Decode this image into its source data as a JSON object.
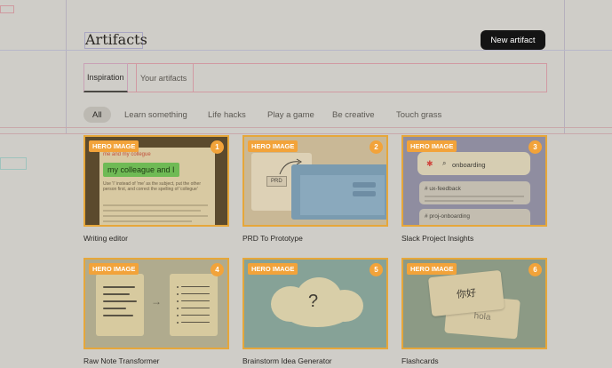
{
  "header": {
    "title": "Artifacts",
    "new_button": "New artifact"
  },
  "tabs": [
    {
      "label": "Inspiration",
      "active": true
    },
    {
      "label": "Your artifacts",
      "active": false
    }
  ],
  "filters": [
    {
      "label": "All",
      "active": true
    },
    {
      "label": "Learn something"
    },
    {
      "label": "Life hacks"
    },
    {
      "label": "Play a game"
    },
    {
      "label": "Be creative"
    },
    {
      "label": "Touch grass"
    }
  ],
  "cards": [
    {
      "badge": "HERO IMAGE",
      "number": "1",
      "label": "Writing editor"
    },
    {
      "badge": "HERO IMAGE",
      "number": "2",
      "label": "PRD To Prototype"
    },
    {
      "badge": "HERO IMAGE",
      "number": "3",
      "label": "Slack Project Insights"
    },
    {
      "badge": "HERO IMAGE",
      "number": "4",
      "label": "Raw Note Transformer"
    },
    {
      "badge": "HERO IMAGE",
      "number": "5",
      "label": "Brainstorm Idea Generator"
    },
    {
      "badge": "HERO IMAGE",
      "number": "6",
      "label": "Flashcards"
    }
  ],
  "card_art": {
    "writing": {
      "red_text": "me and my collegue",
      "green_text": "my colleague and I",
      "hint": "Use 'I' instead of 'me' as the subject, put the other person first, and correct the spelling of 'collegue'"
    },
    "prd": {
      "tag": "PRD"
    },
    "slack": {
      "search": "onboarding",
      "channel1": "# ux-feedback",
      "channel2": "# proj-onboarding"
    },
    "brainstorm": {
      "symbol": "?"
    },
    "flashcards": {
      "front": "你好",
      "back": "hola"
    }
  },
  "colors": {
    "accent": "#f2a33a",
    "button_bg": "#141414",
    "background": "#cfcdc8"
  }
}
